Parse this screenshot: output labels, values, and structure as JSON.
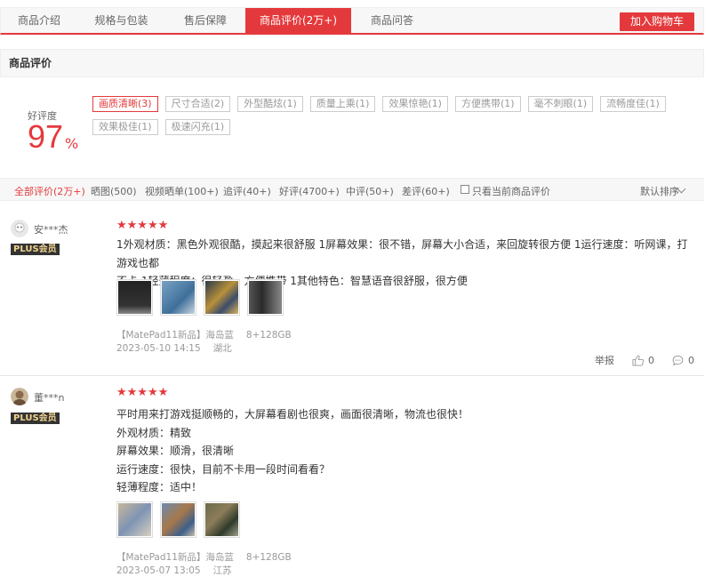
{
  "tabs": [
    {
      "label": "商品介绍",
      "active": false
    },
    {
      "label": "规格与包装",
      "active": false
    },
    {
      "label": "售后保障",
      "active": false
    },
    {
      "label": "商品评价(2万+)",
      "active": true
    },
    {
      "label": "商品问答",
      "active": false
    }
  ],
  "cart_button": "加入购物车",
  "section_title": "商品评价",
  "rating": {
    "label": "好评度",
    "value": "97",
    "unit": "%"
  },
  "tags": [
    {
      "label": "画质清晰(3)",
      "active": true
    },
    {
      "label": "尺寸合适(2)",
      "active": false
    },
    {
      "label": "外型酷炫(1)",
      "active": false
    },
    {
      "label": "质量上乘(1)",
      "active": false
    },
    {
      "label": "效果惊艳(1)",
      "active": false
    },
    {
      "label": "方便携带(1)",
      "active": false
    },
    {
      "label": "毫不刺眼(1)",
      "active": false
    },
    {
      "label": "流畅度佳(1)",
      "active": false
    },
    {
      "label": "效果极佳(1)",
      "active": false
    },
    {
      "label": "极速闪充(1)",
      "active": false
    }
  ],
  "filters": [
    {
      "label": "全部评价(2万+)",
      "active": true
    },
    {
      "label": "晒图(500)",
      "active": false
    },
    {
      "label": "视频晒单(100+)",
      "active": false
    },
    {
      "label": "追评(40+)",
      "active": false
    },
    {
      "label": "好评(4700+)",
      "active": false
    },
    {
      "label": "中评(50+)",
      "active": false
    },
    {
      "label": "差评(60+)",
      "active": false
    }
  ],
  "only_current_label": "只看当前商品评价",
  "sort_label": "默认排序",
  "colors": {
    "accent": "#e4393c",
    "plus_bg": "#333333",
    "plus_text": "#f1d38d"
  },
  "reviews": [
    {
      "user": "安***杰",
      "badge": "PLUS会员",
      "stars": "★★★★★",
      "lines": [
        "1外观材质：黑色外观很酷，摸起来很舒服 1屏幕效果：很不错，屏幕大小合适，来回旋转很方便 1运行速度：听网课，打游戏也都",
        "不卡 1轻薄程度：很轻盈，方便携带 1其他特色：智慧语音很舒服，很方便"
      ],
      "product": "【MatePad11新品】海岛蓝",
      "spec": "8+128GB",
      "time": "2023-05-10 14:15",
      "location": "湖北",
      "report": "举报",
      "likes": "0",
      "comments": "0"
    },
    {
      "user": "董***n",
      "badge": "PLUS会员",
      "stars": "★★★★★",
      "lines": [
        "平时用来打游戏挺顺畅的，大屏幕看剧也很爽，画面很清晰，物流也很快！",
        "外观材质：精致",
        "屏幕效果：顺滑，很清晰",
        "运行速度：很快，目前不卡用一段时间看看？",
        "轻薄程度：适中！"
      ],
      "product": "【MatePad11新品】海岛蓝",
      "spec": "8+128GB",
      "time": "2023-05-07 13:05",
      "location": "江苏"
    }
  ]
}
